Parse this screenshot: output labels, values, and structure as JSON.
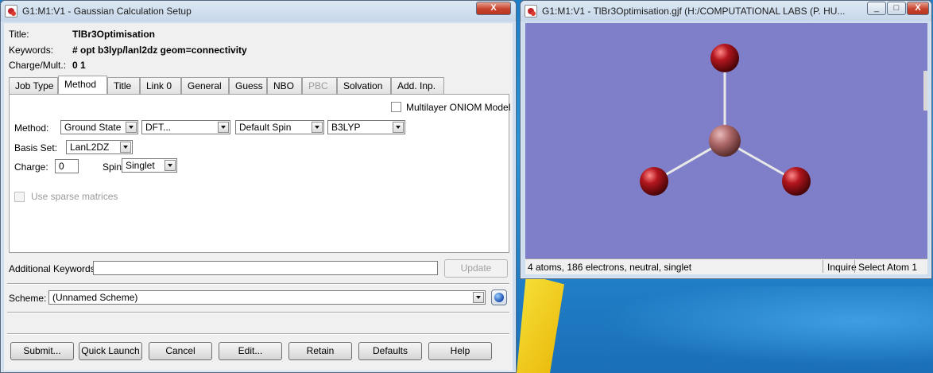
{
  "setup_window": {
    "title": "G1:M1:V1 - Gaussian Calculation Setup",
    "caption_buttons": {
      "minimize": "_",
      "close": "X"
    },
    "fields": {
      "title_label": "Title:",
      "title_value": "TlBr3Optimisation",
      "keywords_label": "Keywords:",
      "keywords_value": "# opt b3lyp/lanl2dz geom=connectivity",
      "charge_mult_label": "Charge/Mult.:",
      "charge_mult_value": "0 1"
    },
    "tabs": [
      {
        "label": "Job Type",
        "state": "normal"
      },
      {
        "label": "Method",
        "state": "active"
      },
      {
        "label": "Title",
        "state": "normal"
      },
      {
        "label": "Link 0",
        "state": "normal"
      },
      {
        "label": "General",
        "state": "normal"
      },
      {
        "label": "Guess",
        "state": "normal"
      },
      {
        "label": "NBO",
        "state": "normal"
      },
      {
        "label": "PBC",
        "state": "disabled"
      },
      {
        "label": "Solvation",
        "state": "normal"
      },
      {
        "label": "Add. Inp.",
        "state": "normal"
      }
    ],
    "method_tab": {
      "oniom_label": "Multilayer ONIOM Model",
      "oniom_checked": false,
      "method_label": "Method:",
      "method_state": "Ground State",
      "method_type": "DFT...",
      "spin_option": "Default Spin",
      "functional": "B3LYP",
      "basis_label": "Basis Set:",
      "basis_value": "LanL2DZ",
      "charge_label": "Charge:",
      "charge_value": "0",
      "spin_label": "Spin:",
      "spin_value": "Singlet",
      "sparse_label": "Use sparse matrices",
      "sparse_checked": false
    },
    "additional_keywords_label": "Additional Keywords:",
    "additional_keywords_value": "",
    "update_label": "Update",
    "scheme_label": "Scheme:",
    "scheme_value": "(Unnamed Scheme)",
    "buttons": {
      "submit": "Submit...",
      "quick_launch": "Quick Launch",
      "cancel": "Cancel",
      "edit": "Edit...",
      "retain": "Retain",
      "defaults": "Defaults",
      "help": "Help"
    }
  },
  "viewer_window": {
    "title": "G1:M1:V1 - TlBr3Optimisation.gjf (H:/COMPUTATIONAL LABS (P. HU...",
    "caption_buttons": {
      "minimize": "_",
      "maximize": "□",
      "close": "X"
    },
    "molecule": {
      "background_color": "#7f7fc9",
      "atoms": [
        {
          "element": "Tl",
          "color": "#b06a6a"
        },
        {
          "element": "Br",
          "color": "#b3161d"
        },
        {
          "element": "Br",
          "color": "#b3161d"
        },
        {
          "element": "Br",
          "color": "#b3161d"
        }
      ]
    },
    "status": {
      "summary": "4 atoms, 186 electrons, neutral, singlet",
      "mode": "Inquire",
      "action": "Select Atom 1"
    }
  }
}
